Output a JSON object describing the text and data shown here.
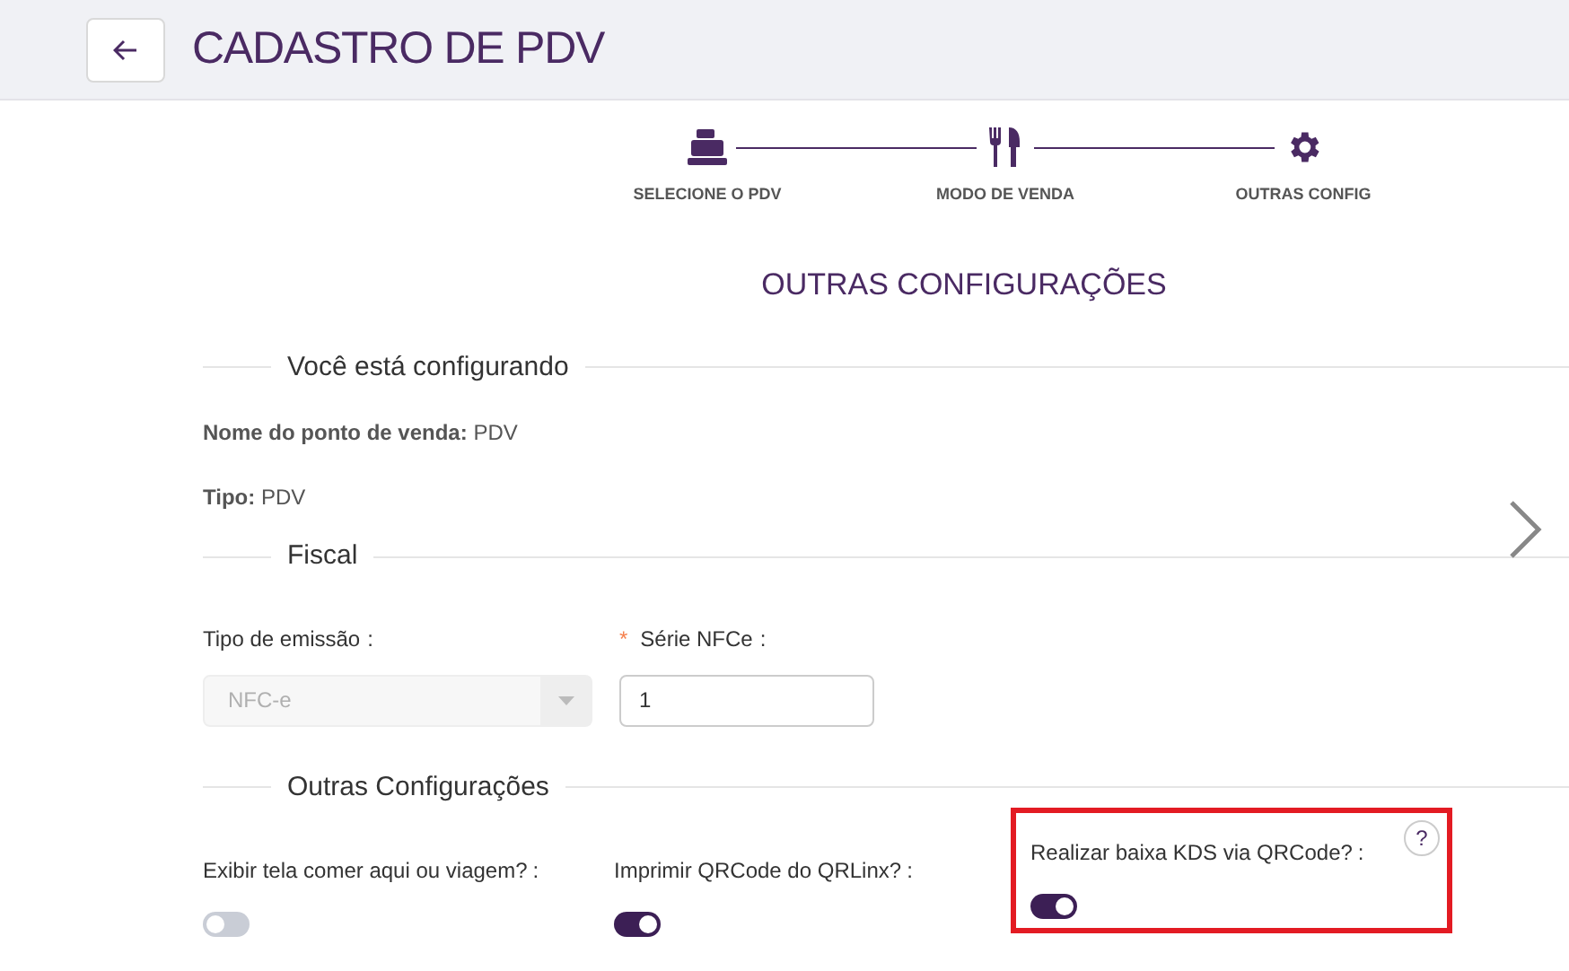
{
  "header": {
    "title": "CADASTRO DE PDV"
  },
  "steps": [
    {
      "label": "SELECIONE O PDV",
      "kind": "register"
    },
    {
      "label": "MODO DE VENDA",
      "kind": "cutlery"
    },
    {
      "label": "OUTRAS CONFIG",
      "kind": "gear"
    }
  ],
  "page_title": "OUTRAS CONFIGURAÇÕES",
  "summary": {
    "heading": "Você está configurando",
    "rows": [
      {
        "label": "Nome do ponto de venda:",
        "value": "PDV"
      },
      {
        "label": "Tipo:",
        "value": "PDV"
      }
    ]
  },
  "fiscal": {
    "heading": "Fiscal",
    "fields": [
      {
        "kind": "select",
        "label": "Tipo de emissão",
        "colon": ":",
        "value": "NFC-e",
        "disabled": true
      },
      {
        "kind": "input",
        "required_mark": "*",
        "label": "Série NFCe",
        "colon": ":",
        "value": "1",
        "disabled": false
      }
    ]
  },
  "other": {
    "heading": "Outras Configurações",
    "toggles": [
      {
        "label": "Exibir tela comer aqui ou viagem?",
        "colon": ":",
        "on": false,
        "highlighted": false
      },
      {
        "label": "Imprimir QRCode do QRLinx?",
        "colon": ":",
        "on": true,
        "highlighted": false
      },
      {
        "label": "Realizar baixa KDS via QRCode?",
        "colon": ":",
        "on": true,
        "highlighted": true,
        "help_text": "?"
      }
    ]
  }
}
